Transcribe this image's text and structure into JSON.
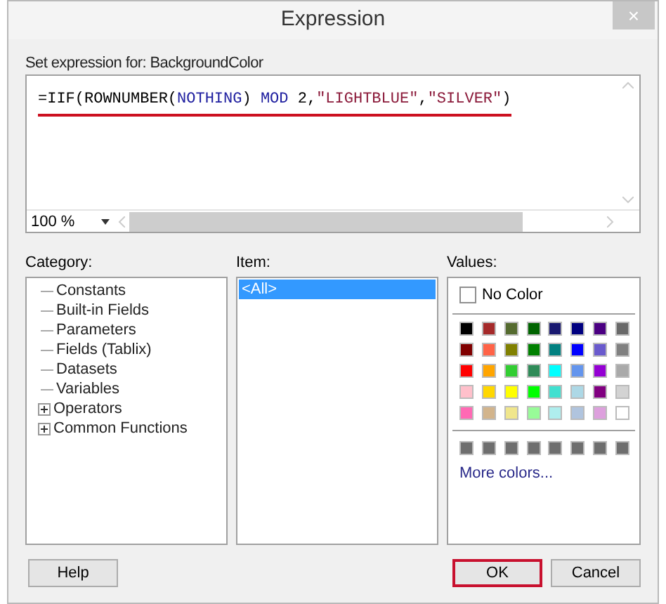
{
  "window": {
    "title": "Expression",
    "close": "×"
  },
  "expression": {
    "label": "Set expression for: BackgroundColor",
    "underlined": true,
    "tokens": [
      {
        "text": "=IIF(ROWNUMBER(",
        "kind": "plain"
      },
      {
        "text": "NOTHING",
        "kind": "keyword"
      },
      {
        "text": ") ",
        "kind": "plain"
      },
      {
        "text": "MOD",
        "kind": "keyword"
      },
      {
        "text": " 2,",
        "kind": "plain"
      },
      {
        "text": "\"LIGHTBLUE\"",
        "kind": "string"
      },
      {
        "text": ",",
        "kind": "plain"
      },
      {
        "text": "\"SILVER\"",
        "kind": "string"
      },
      {
        "text": ")",
        "kind": "plain"
      }
    ],
    "zoom": "100 %"
  },
  "category": {
    "label": "Category:",
    "items": [
      {
        "label": "Constants",
        "expandable": false
      },
      {
        "label": "Built-in Fields",
        "expandable": false
      },
      {
        "label": "Parameters",
        "expandable": false
      },
      {
        "label": "Fields (Tablix)",
        "expandable": false
      },
      {
        "label": "Datasets",
        "expandable": false
      },
      {
        "label": "Variables",
        "expandable": false
      },
      {
        "label": "Operators",
        "expandable": true
      },
      {
        "label": "Common Functions",
        "expandable": true
      }
    ]
  },
  "item": {
    "label": "Item:",
    "items": [
      {
        "label": "<All>",
        "selected": true
      }
    ]
  },
  "values": {
    "label": "Values:",
    "no_color": {
      "label": "No Color",
      "checked": false
    },
    "colors": [
      {
        "color": "#000000"
      },
      {
        "color": "#a52a2a"
      },
      {
        "color": "#556b2f"
      },
      {
        "color": "#006400"
      },
      {
        "color": "#191970"
      },
      {
        "color": "#000080"
      },
      {
        "color": "#4b0082"
      },
      {
        "color": "#696969"
      },
      {
        "color": "#800000"
      },
      {
        "color": "#ff6347"
      },
      {
        "color": "#808000"
      },
      {
        "color": "#008000"
      },
      {
        "color": "#008080"
      },
      {
        "color": "#0000ff"
      },
      {
        "color": "#6a5acd"
      },
      {
        "color": "#808080"
      },
      {
        "color": "#ff0000"
      },
      {
        "color": "#ffa500"
      },
      {
        "color": "#32cd32"
      },
      {
        "color": "#2e8b57"
      },
      {
        "color": "#00ffff"
      },
      {
        "color": "#6495ed"
      },
      {
        "color": "#9400d3"
      },
      {
        "color": "#a9a9a9"
      },
      {
        "color": "#ffc0cb"
      },
      {
        "color": "#ffd700"
      },
      {
        "color": "#ffff00"
      },
      {
        "color": "#00ff00"
      },
      {
        "color": "#40e0d0"
      },
      {
        "color": "#add8e6"
      },
      {
        "color": "#800080"
      },
      {
        "color": "#d3d3d3"
      },
      {
        "color": "#ff69b4"
      },
      {
        "color": "#d2b48c"
      },
      {
        "color": "#f0e68c"
      },
      {
        "color": "#98fb98"
      },
      {
        "color": "#afeeee"
      },
      {
        "color": "#b0c4de"
      },
      {
        "color": "#dda0dd"
      },
      {
        "color": "#ffffff"
      }
    ],
    "custom_colors": [
      {
        "color": "#6e6e6e"
      },
      {
        "color": "#6e6e6e"
      },
      {
        "color": "#6e6e6e"
      },
      {
        "color": "#6e6e6e"
      },
      {
        "color": "#6e6e6e"
      },
      {
        "color": "#6e6e6e"
      },
      {
        "color": "#6e6e6e"
      },
      {
        "color": "#6e6e6e"
      }
    ],
    "more": "More colors..."
  },
  "buttons": [
    {
      "label": "Help",
      "highlighted": false
    },
    {
      "label": "OK",
      "highlighted": true
    },
    {
      "label": "Cancel",
      "highlighted": false
    }
  ]
}
